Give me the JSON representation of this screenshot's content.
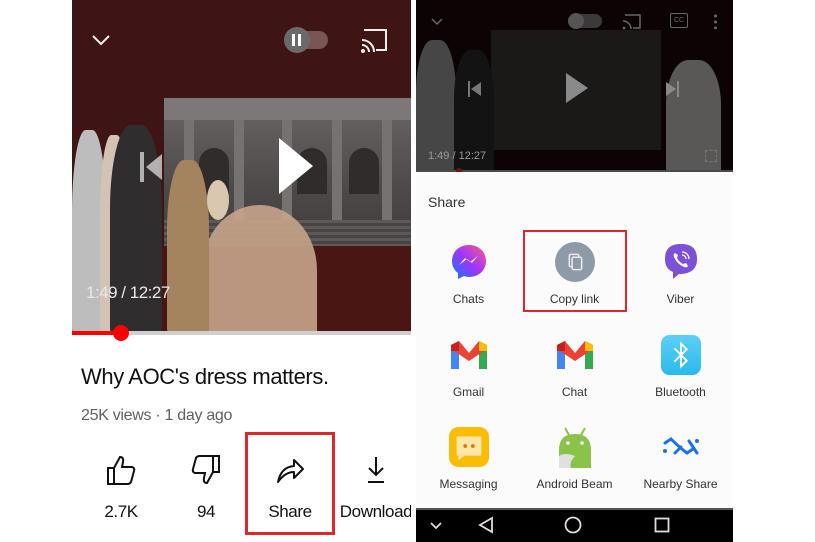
{
  "left_screen": {
    "player": {
      "current_time": "1:49",
      "duration": "12:27",
      "time_display": "1:49 / 12:27",
      "progress_fraction": 0.146,
      "autoplay_toggle_state": "paused",
      "icons": {
        "minimize": "chevron-down-icon",
        "autoplay": "autoplay-toggle-icon",
        "cast": "cast-icon",
        "previous": "skip-previous-icon",
        "play": "play-icon"
      }
    },
    "video": {
      "title": "Why AOC's dress matters.",
      "meta": "25K views · 1 day ago"
    },
    "actions": [
      {
        "id": "like",
        "icon": "thumbs-up-icon",
        "label": "2.7K"
      },
      {
        "id": "dislike",
        "icon": "thumbs-down-icon",
        "label": "94"
      },
      {
        "id": "share",
        "icon": "share-arrow-icon",
        "label": "Share",
        "highlighted": true
      },
      {
        "id": "download",
        "icon": "download-icon",
        "label": "Download"
      }
    ]
  },
  "right_screen": {
    "player": {
      "time_display": "1:49 / 12:27",
      "icons": [
        "chevron-down-icon",
        "autoplay-toggle-icon",
        "cast-icon",
        "captions-icon",
        "more-vert-icon",
        "skip-previous-icon",
        "play-icon",
        "skip-next-icon",
        "fullscreen-icon"
      ]
    },
    "share_sheet": {
      "title": "Share",
      "apps": [
        {
          "label": "Chats",
          "icon": "messenger-icon",
          "color": "#8a3ffc"
        },
        {
          "label": "Copy link",
          "icon": "copy-link-icon",
          "color": "#8e9aa7",
          "highlighted": true
        },
        {
          "label": "Viber",
          "icon": "viber-icon",
          "color": "#7b51d8"
        },
        {
          "label": "Gmail",
          "icon": "gmail-icon",
          "color": "#ea4335"
        },
        {
          "label": "Chat",
          "icon": "gmail-chat-icon",
          "color": "#ea4335"
        },
        {
          "label": "Bluetooth",
          "icon": "bluetooth-icon",
          "color": "#3ec5f3"
        },
        {
          "label": "Messaging",
          "icon": "messaging-icon",
          "color": "#fbbc05"
        },
        {
          "label": "Android Beam",
          "icon": "android-beam-icon",
          "color": "#8bc34a"
        },
        {
          "label": "Nearby Share",
          "icon": "nearby-share-icon",
          "color": "#1a73e8"
        }
      ]
    },
    "nav_bar": {
      "buttons": [
        "hide-keyboard-icon",
        "back-icon",
        "home-icon",
        "recents-icon"
      ]
    }
  },
  "colors": {
    "highlight": "#e0262b",
    "progress": "#ff0000",
    "video_bg": "#3e1514"
  }
}
